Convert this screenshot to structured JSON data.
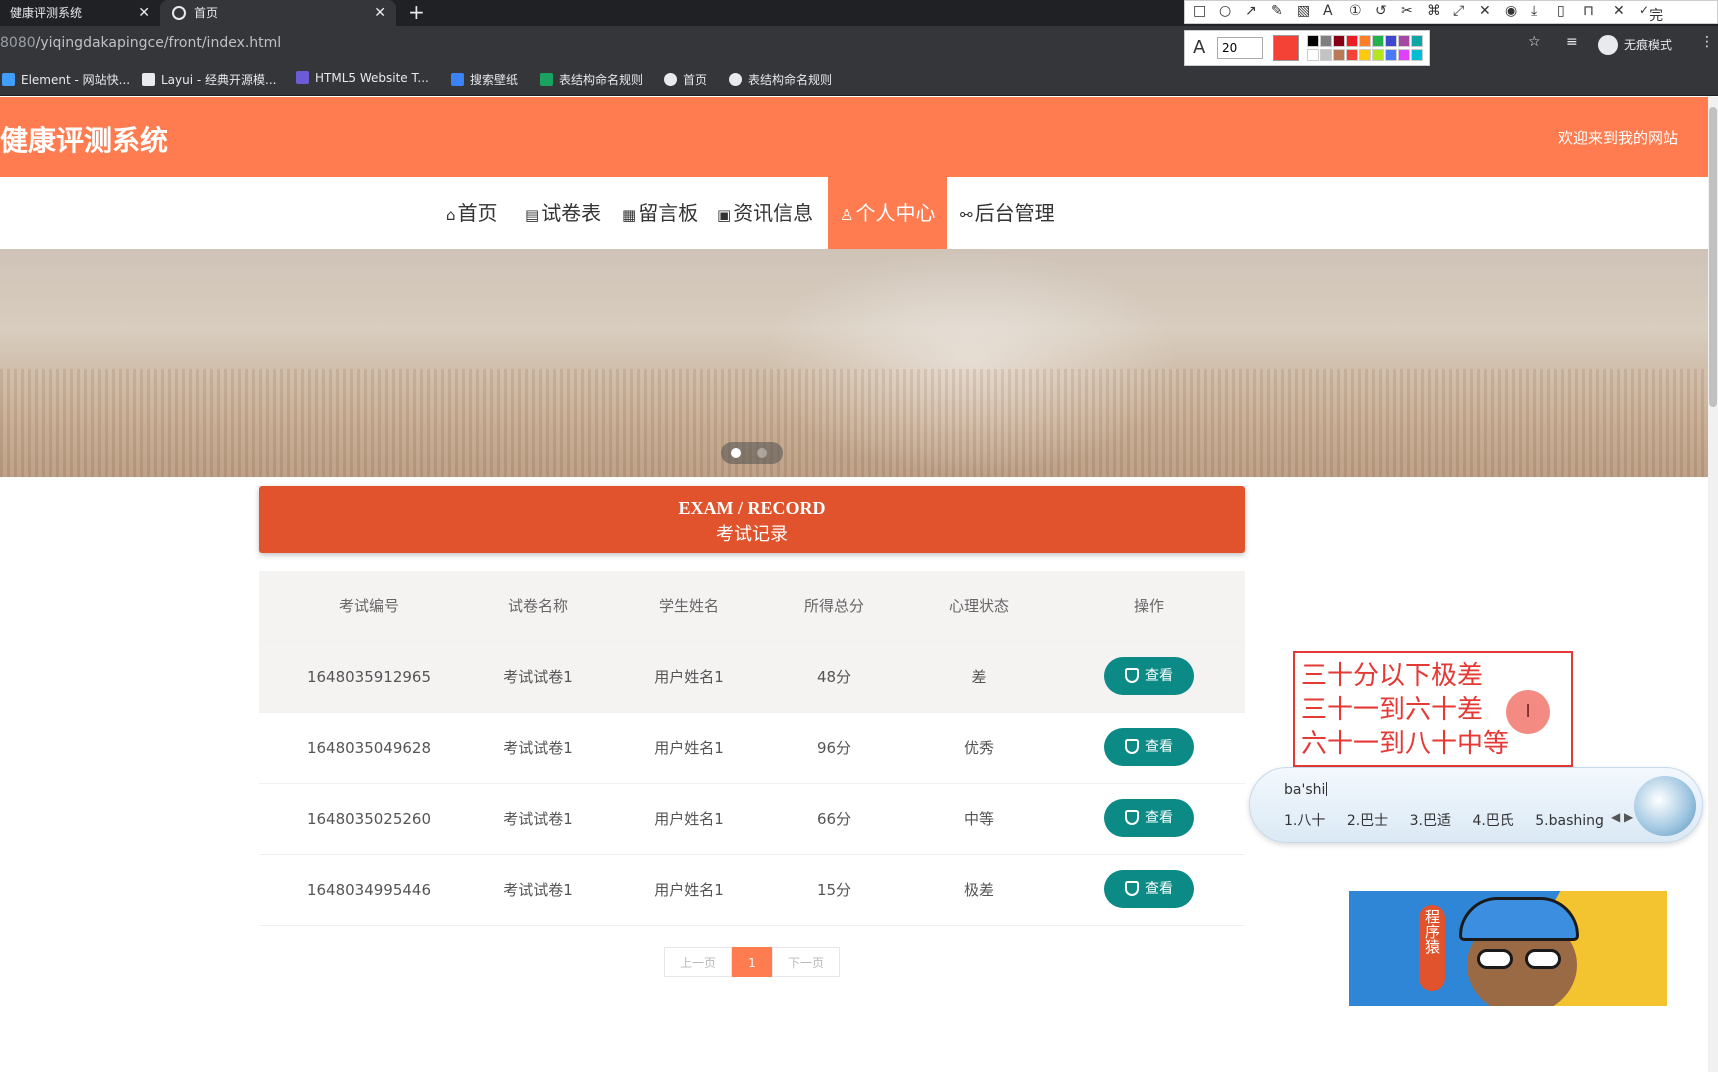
{
  "browser": {
    "tabs": [
      {
        "title": "健康评测系统",
        "active": false
      },
      {
        "title": "首页",
        "active": true
      }
    ],
    "new_tab": "+",
    "url_host": "8080",
    "url_path": "/yiqingdakapingce/front/index.html",
    "incognito_label": "无痕模式",
    "bookmarks": [
      {
        "label": "Element - 网站快...",
        "icon_color": "#409eff"
      },
      {
        "label": "Layui - 经典开源模...",
        "icon_color": "#e8eaed"
      },
      {
        "label": "HTML5 Website T...",
        "icon_color": "#6b5bd6"
      },
      {
        "label": "搜索壁纸",
        "icon_color": "#3b82f6"
      },
      {
        "label": "表结构命名规则",
        "icon_color": "#1aa260"
      },
      {
        "label": "首页",
        "icon_color": "#e8eaed"
      },
      {
        "label": "表结构命名规则",
        "icon_color": "#e8eaed"
      }
    ]
  },
  "screenshot_tool": {
    "done_label": "完成",
    "font_size": "20",
    "current_color": "#f44336",
    "swatches": [
      "#000000",
      "#7f7f7f",
      "#880015",
      "#ed1c24",
      "#ff7f27",
      "#22b14c",
      "#3f48cc",
      "#a349a4",
      "#0ea5a5",
      "#ffffff",
      "#c3c3c3",
      "#b97a57",
      "#f44336",
      "#ffc90e",
      "#b5e61d",
      "#4a7bf7",
      "#e040fb",
      "#00bcd4"
    ]
  },
  "site": {
    "title": "健康评测系统",
    "welcome": "欢迎来到我的网站",
    "accent": "#fe7c4f",
    "nav": [
      {
        "icon": "home-icon",
        "glyph": "⌂",
        "label": "首页",
        "active": false
      },
      {
        "icon": "exam-icon",
        "glyph": "▤",
        "label": "试卷表",
        "active": false
      },
      {
        "icon": "board-icon",
        "glyph": "▦",
        "label": "留言板",
        "active": false
      },
      {
        "icon": "news-icon",
        "glyph": "▣",
        "label": "资讯信息",
        "active": false
      },
      {
        "icon": "user-icon",
        "glyph": "♙",
        "label": "个人中心",
        "active": true
      },
      {
        "icon": "link-icon",
        "glyph": "⚯",
        "label": "后台管理",
        "active": false
      }
    ]
  },
  "section": {
    "title_en": "EXAM / RECORD",
    "title_zh": "考试记录",
    "color": "#e0532c"
  },
  "table": {
    "columns": [
      "考试编号",
      "试卷名称",
      "学生姓名",
      "所得总分",
      "心理状态",
      "操作"
    ],
    "rows": [
      [
        "1648035912965",
        "考试试卷1",
        "用户姓名1",
        "48分",
        "差"
      ],
      [
        "1648035049628",
        "考试试卷1",
        "用户姓名1",
        "96分",
        "优秀"
      ],
      [
        "1648035025260",
        "考试试卷1",
        "用户姓名1",
        "66分",
        "中等"
      ],
      [
        "1648034995446",
        "考试试卷1",
        "用户姓名1",
        "15分",
        "极差"
      ]
    ],
    "view_label": "查看",
    "button_color": "#0c8a86"
  },
  "pagination": {
    "prev": "上一页",
    "current": "1",
    "next": "下一页"
  },
  "annotation": {
    "lines": [
      "三十分以下极差",
      "三十一到六十差",
      "六十一到八十中等"
    ],
    "color": "#e53935"
  },
  "ime": {
    "input": "ba'shi",
    "candidates": [
      "1.八十",
      "2.巴士",
      "3.巴适",
      "4.巴氏",
      "5.bashing"
    ]
  },
  "mascot": {
    "tag": "程序猿"
  }
}
